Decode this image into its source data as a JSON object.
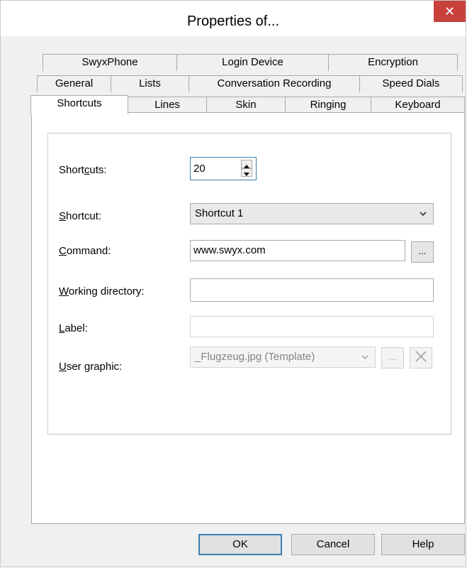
{
  "window": {
    "title": "Properties of...",
    "close_glyph": "✕"
  },
  "tabs": {
    "row1": [
      "SwyxPhone",
      "Login Device",
      "Encryption"
    ],
    "row2": [
      "General",
      "Lists",
      "Conversation Recording",
      "Speed Dials"
    ],
    "row3": [
      "Shortcuts",
      "Lines",
      "Skin",
      "Ringing",
      "Keyboard"
    ],
    "active": "Shortcuts"
  },
  "form": {
    "shortcuts_label_pre": "Short",
    "shortcuts_label_u": "c",
    "shortcuts_label_post": "uts:",
    "shortcuts_value": "20",
    "shortcut_label_u": "S",
    "shortcut_label_post": "hortcut:",
    "shortcut_value": "Shortcut 1",
    "command_label_u": "C",
    "command_label_post": "ommand:",
    "command_value": "www.swyx.com",
    "browse_label": "...",
    "working_dir_label_u": "W",
    "working_dir_label_post": "orking directory:",
    "working_dir_value": "",
    "label_label_u": "L",
    "label_label_post": "abel:",
    "label_value": "",
    "user_graphic_label_u": "U",
    "user_graphic_label_post": "ser graphic:",
    "user_graphic_value": "_Flugzeug.jpg (Template)",
    "graphic_browse_label": "...",
    "graphic_delete_glyph": "✕"
  },
  "buttons": {
    "ok": "OK",
    "cancel": "Cancel",
    "help": "Help"
  },
  "colors": {
    "accent": "#3c7fb1",
    "close": "#c8413b"
  }
}
